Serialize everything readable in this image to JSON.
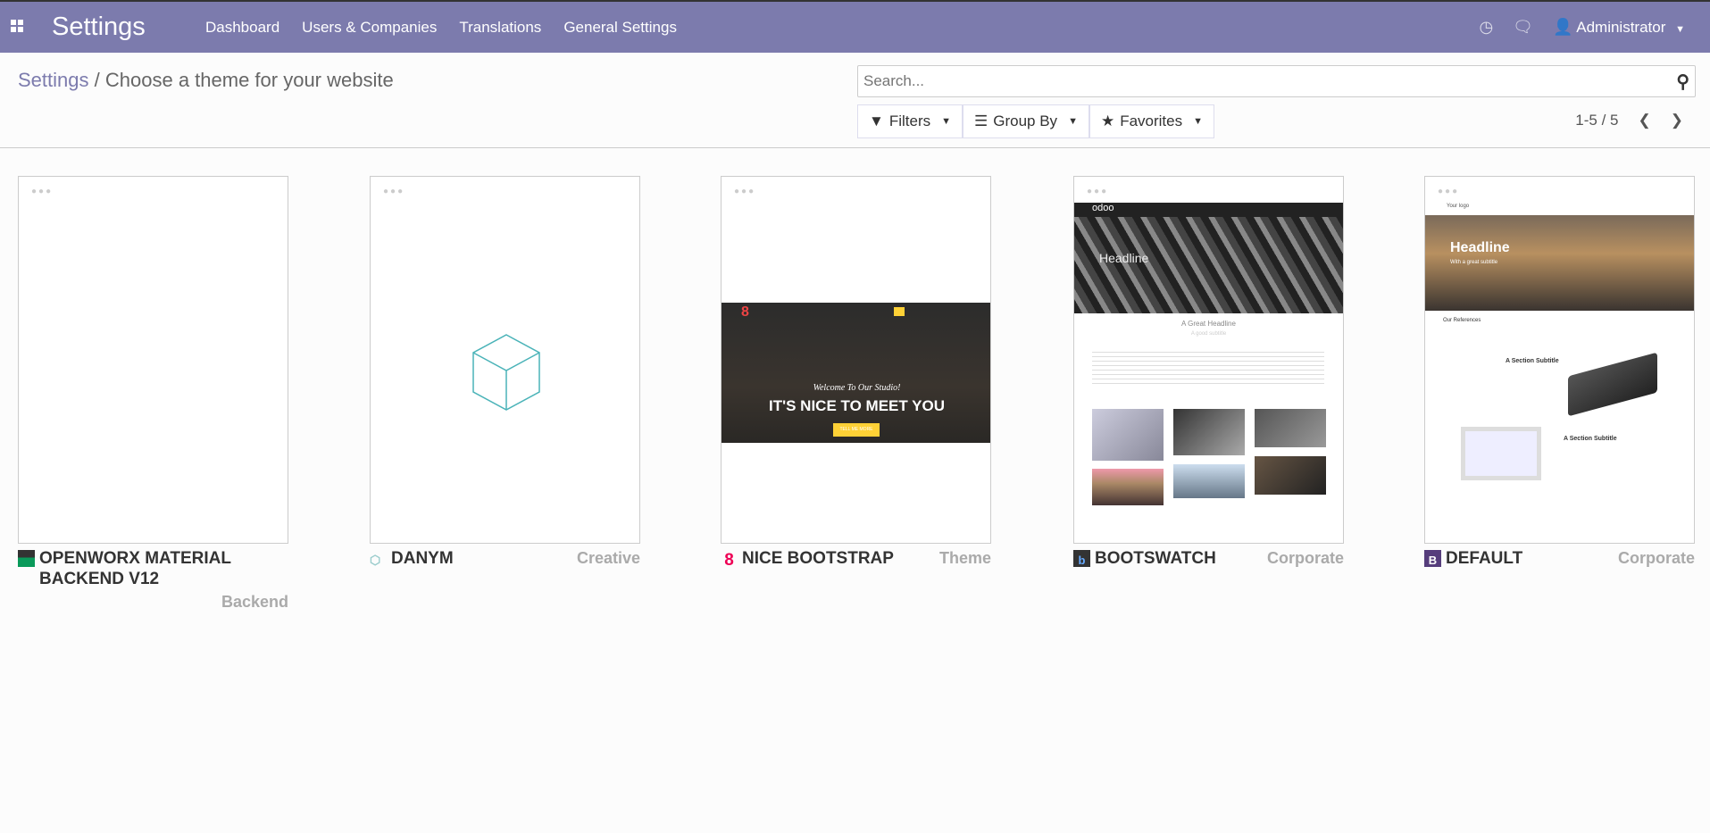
{
  "navbar": {
    "app_title": "Settings",
    "menu": [
      "Dashboard",
      "Users & Companies",
      "Translations",
      "General Settings"
    ],
    "user": "Administrator",
    "bg_color": "#7c7bad"
  },
  "breadcrumb": {
    "parent": "Settings",
    "separator": "/",
    "current": "Choose a theme for your website"
  },
  "search": {
    "placeholder": "Search...",
    "value": ""
  },
  "filters": {
    "filters": "Filters",
    "group_by": "Group By",
    "favorites": "Favorites"
  },
  "pager": {
    "range": "1-5 / 5"
  },
  "themes": [
    {
      "name": "OPENWORX MATERIAL BACKEND V12",
      "category": "Backend"
    },
    {
      "name": "DANYM",
      "category": "Creative"
    },
    {
      "name": "NICE BOOTSTRAP",
      "category": "Theme",
      "preview": {
        "tagline": "Welcome To Our Studio!",
        "headline": "IT'S NICE TO MEET YOU",
        "button": "TELL ME MORE"
      }
    },
    {
      "name": "BOOTSWATCH",
      "category": "Corporate",
      "preview": {
        "logo": "odoo",
        "headline": "Headline",
        "section": "A Great Headline",
        "subtitle": "A good subtitle"
      }
    },
    {
      "name": "DEFAULT",
      "category": "Corporate",
      "preview": {
        "logo": "Your logo",
        "headline": "Headline",
        "subtitle": "With a great subtitle",
        "references": "Our References",
        "section1": "A Section Subtitle",
        "section2": "A Section Subtitle"
      }
    }
  ]
}
